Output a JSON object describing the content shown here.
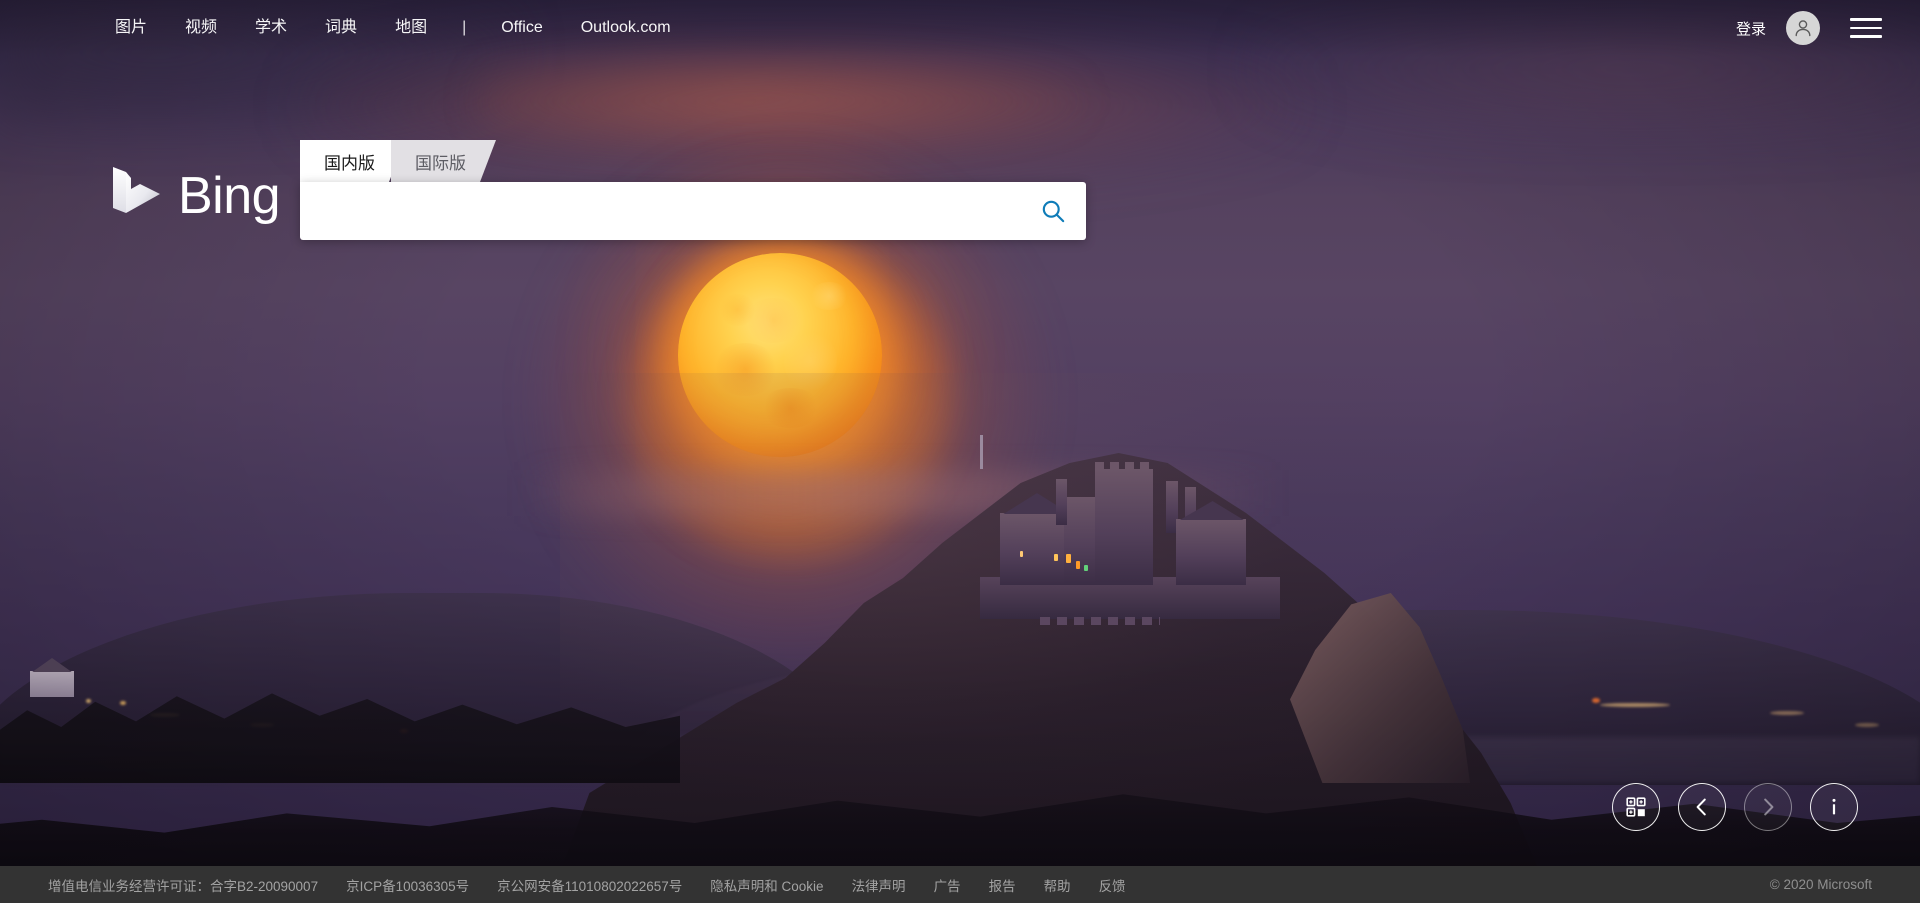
{
  "header": {
    "nav_items": [
      {
        "label": "图片",
        "name": "nav-images"
      },
      {
        "label": "视频",
        "name": "nav-videos"
      },
      {
        "label": "学术",
        "name": "nav-academic"
      },
      {
        "label": "词典",
        "name": "nav-dictionary"
      },
      {
        "label": "地图",
        "name": "nav-maps"
      }
    ],
    "divider": "|",
    "nav_items_right": [
      {
        "label": "Office",
        "name": "nav-office"
      },
      {
        "label": "Outlook.com",
        "name": "nav-outlook"
      }
    ],
    "signin_label": "登录",
    "avatar_icon": "person-icon",
    "menu_icon": "hamburger-menu-icon"
  },
  "brand": {
    "logo_text": "Bing",
    "logo_icon": "bing-logo-icon"
  },
  "search": {
    "tabs": [
      {
        "label": "国内版",
        "active": true,
        "name": "tab-domestic"
      },
      {
        "label": "国际版",
        "active": false,
        "name": "tab-international"
      }
    ],
    "value": "",
    "placeholder": "",
    "search_icon": "search-icon",
    "accent_color": "#0f7cb8"
  },
  "image_controls": [
    {
      "name": "wallpaper-grid-button",
      "icon": "grid-download-icon",
      "enabled": true
    },
    {
      "name": "previous-image-button",
      "icon": "chevron-left-icon",
      "enabled": true
    },
    {
      "name": "next-image-button",
      "icon": "chevron-right-icon",
      "enabled": false
    },
    {
      "name": "image-info-button",
      "icon": "info-icon",
      "enabled": true
    }
  ],
  "footer": {
    "links": [
      {
        "label": "增值电信业务经营许可证：合字B2-20090007",
        "name": "footer-telecom-license",
        "link": false
      },
      {
        "label": "京ICP备10036305号",
        "name": "footer-icp",
        "link": true
      },
      {
        "label": "京公网安备11010802022657号",
        "name": "footer-public-security",
        "link": true
      },
      {
        "label": "隐私声明和 Cookie",
        "name": "footer-privacy",
        "link": true
      },
      {
        "label": "法律声明",
        "name": "footer-legal",
        "link": true
      },
      {
        "label": "广告",
        "name": "footer-advertise",
        "link": true
      },
      {
        "label": "报告",
        "name": "footer-report",
        "link": true
      },
      {
        "label": "帮助",
        "name": "footer-help",
        "link": true
      },
      {
        "label": "反馈",
        "name": "footer-feedback",
        "link": true
      }
    ],
    "copyright": "© 2020 Microsoft"
  },
  "background": {
    "description": "night-landscape-castle-moon",
    "sky_color": "#534062",
    "moon_color": "#ffb62c",
    "land_color": "#2e2340"
  }
}
